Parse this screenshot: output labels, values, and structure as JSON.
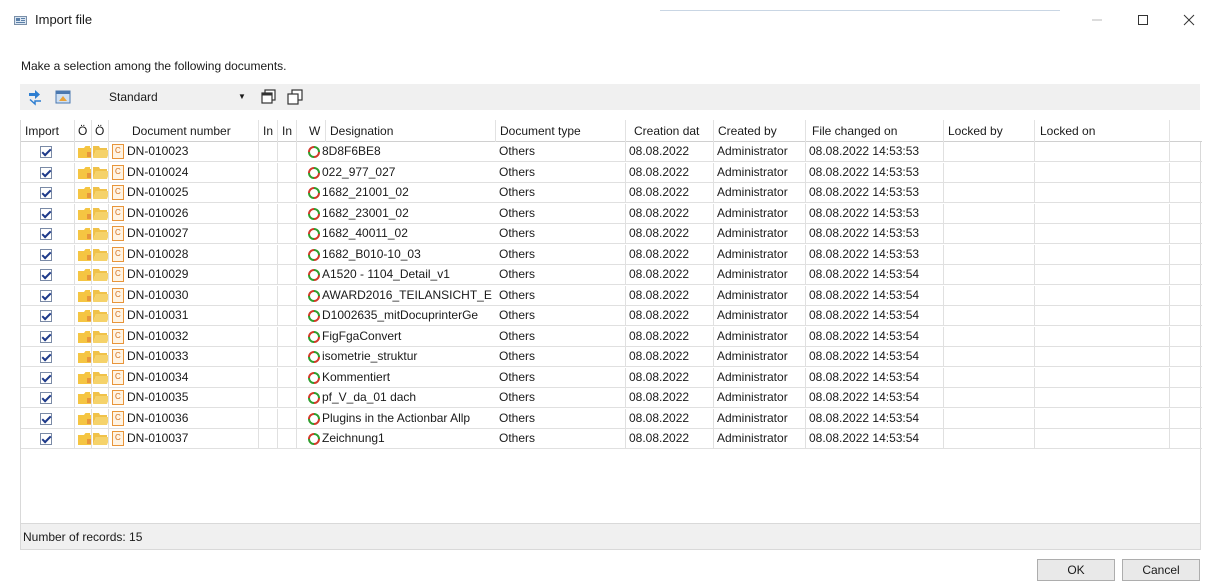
{
  "window": {
    "title": "Import file"
  },
  "instruction": "Make a selection among the following documents.",
  "toolbar": {
    "view_selector": "Standard"
  },
  "columns": [
    "Import",
    "Ö",
    "Ö",
    "Document number",
    "In",
    "In",
    "W",
    "Designation",
    "Document type",
    "Creation dat",
    "Created by",
    "File changed on",
    "Locked by",
    "Locked on"
  ],
  "rows": [
    {
      "checked": true,
      "doc_number": "DN-010023",
      "designation": "8D8F6BE8",
      "type": "Others",
      "created": "08.08.2022",
      "created_by": "Administrator",
      "changed": "08.08.2022 14:53:53"
    },
    {
      "checked": true,
      "doc_number": "DN-010024",
      "designation": "022_977_027",
      "type": "Others",
      "created": "08.08.2022",
      "created_by": "Administrator",
      "changed": "08.08.2022 14:53:53"
    },
    {
      "checked": true,
      "doc_number": "DN-010025",
      "designation": "1682_21001_02",
      "type": "Others",
      "created": "08.08.2022",
      "created_by": "Administrator",
      "changed": "08.08.2022 14:53:53"
    },
    {
      "checked": true,
      "doc_number": "DN-010026",
      "designation": "1682_23001_02",
      "type": "Others",
      "created": "08.08.2022",
      "created_by": "Administrator",
      "changed": "08.08.2022 14:53:53"
    },
    {
      "checked": true,
      "doc_number": "DN-010027",
      "designation": "1682_40011_02",
      "type": "Others",
      "created": "08.08.2022",
      "created_by": "Administrator",
      "changed": "08.08.2022 14:53:53"
    },
    {
      "checked": true,
      "doc_number": "DN-010028",
      "designation": "1682_B010-10_03",
      "type": "Others",
      "created": "08.08.2022",
      "created_by": "Administrator",
      "changed": "08.08.2022 14:53:53"
    },
    {
      "checked": true,
      "doc_number": "DN-010029",
      "designation": "A1520 - 1104_Detail_v1",
      "type": "Others",
      "created": "08.08.2022",
      "created_by": "Administrator",
      "changed": "08.08.2022 14:53:54"
    },
    {
      "checked": true,
      "doc_number": "DN-010030",
      "designation": "AWARD2016_TEILANSICHT_E",
      "type": "Others",
      "created": "08.08.2022",
      "created_by": "Administrator",
      "changed": "08.08.2022 14:53:54"
    },
    {
      "checked": true,
      "doc_number": "DN-010031",
      "designation": "D1002635_mitDocuprinterGe",
      "type": "Others",
      "created": "08.08.2022",
      "created_by": "Administrator",
      "changed": "08.08.2022 14:53:54"
    },
    {
      "checked": true,
      "doc_number": "DN-010032",
      "designation": "FigFgaConvert",
      "type": "Others",
      "created": "08.08.2022",
      "created_by": "Administrator",
      "changed": "08.08.2022 14:53:54"
    },
    {
      "checked": true,
      "doc_number": "DN-010033",
      "designation": "isometrie_struktur",
      "type": "Others",
      "created": "08.08.2022",
      "created_by": "Administrator",
      "changed": "08.08.2022 14:53:54"
    },
    {
      "checked": true,
      "doc_number": "DN-010034",
      "designation": "Kommentiert",
      "type": "Others",
      "created": "08.08.2022",
      "created_by": "Administrator",
      "changed": "08.08.2022 14:53:54"
    },
    {
      "checked": true,
      "doc_number": "DN-010035",
      "designation": "pf_V_da_01 dach",
      "type": "Others",
      "created": "08.08.2022",
      "created_by": "Administrator",
      "changed": "08.08.2022 14:53:54"
    },
    {
      "checked": true,
      "doc_number": "DN-010036",
      "designation": "Plugins in the Actionbar Allp",
      "type": "Others",
      "created": "08.08.2022",
      "created_by": "Administrator",
      "changed": "08.08.2022 14:53:54"
    },
    {
      "checked": true,
      "doc_number": "DN-010037",
      "designation": "Zeichnung1",
      "type": "Others",
      "created": "08.08.2022",
      "created_by": "Administrator",
      "changed": "08.08.2022 14:53:54"
    }
  ],
  "footer": {
    "record_count": "Number of records: 15"
  },
  "buttons": {
    "ok": "OK",
    "cancel": "Cancel"
  },
  "colors": {
    "folder": "#f5c542",
    "folder_open": "#f0c24a",
    "doc": "#e8953a",
    "sync_green": "#2f9e2f",
    "sync_red": "#d23a2a",
    "toolbar_bg": "#f0f0f0"
  }
}
